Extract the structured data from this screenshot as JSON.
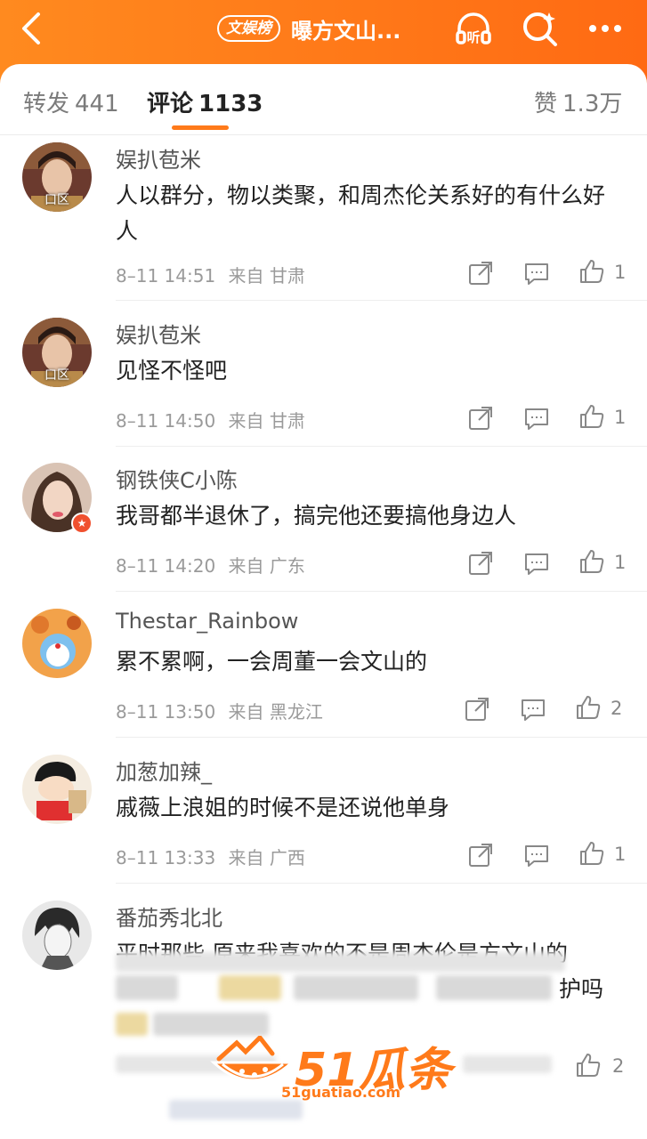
{
  "header": {
    "tag": "文娱榜",
    "title": "曝方文山...",
    "back_icon": "chevron-left-icon",
    "listen_icon": "headphones-icon",
    "listen_label": "听",
    "search_icon": "search-sparkle-icon",
    "more_icon": "more-dots-icon"
  },
  "tabs": [
    {
      "label": "转发",
      "count": "441"
    },
    {
      "label": "评论",
      "count": "1133"
    },
    {
      "label": "赞",
      "count": "1.3万"
    }
  ],
  "comments": [
    {
      "user": "娱扒苞米",
      "avatar_badge": "口区",
      "text": "人以群分，物以类聚，和周杰伦关系好的有什么好人",
      "time": "8–11 14:51",
      "source": "来自 甘肃",
      "likes": "1"
    },
    {
      "user": "娱扒苞米",
      "avatar_badge": "口区",
      "text": "见怪不怪吧",
      "time": "8–11 14:50",
      "source": "来自 甘肃",
      "likes": "1"
    },
    {
      "user": "钢铁侠C小陈",
      "text": "我哥都半退休了，搞完他还要搞他身边人",
      "time": "8–11 14:20",
      "source": "来自 广东",
      "likes": "1"
    },
    {
      "user": "Thestar_Rainbow",
      "text": "累不累啊，一会周董一会文山的",
      "time": "8–11 13:50",
      "source": "来自 黑龙江",
      "likes": "2"
    },
    {
      "user": "加葱加辣_",
      "text": "戚薇上浪姐的时候不是还说他单身",
      "time": "8–11 13:33",
      "source": "来自 广西",
      "likes": "1"
    },
    {
      "user": "番茄秀北北",
      "text_first_line": "平时那些 原来我喜欢的不是周杰伦是方文山的",
      "text_partial": "护吗",
      "likes": "2"
    }
  ],
  "watermark": {
    "brand": "51瓜条",
    "url": "51guatiao.com"
  },
  "colors": {
    "header_orange": "#ff7a1a",
    "text_dark": "#222222",
    "text_gray": "#9a9a9a"
  }
}
